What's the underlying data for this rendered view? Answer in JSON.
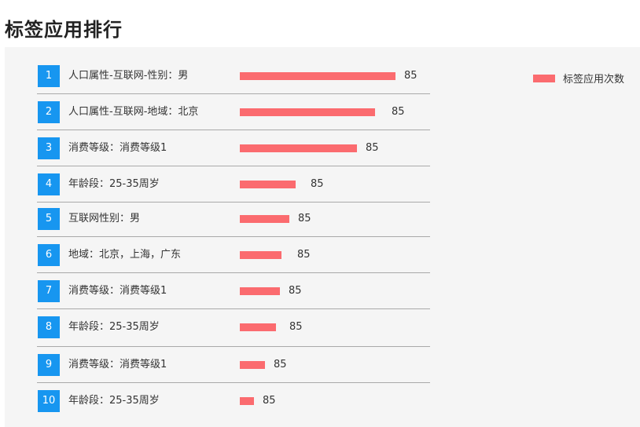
{
  "page": {
    "title": "标签应用排行"
  },
  "chart_data": {
    "type": "bar",
    "orientation": "horizontal",
    "legend": {
      "label": "标签应用次数",
      "placement": "top-right",
      "color": "#fb6b6f"
    },
    "colors": {
      "bar": "#fb6b6f",
      "rank_badge": "#1796f0"
    },
    "bar_value_scale_max": 100,
    "items": [
      {
        "rank": "1",
        "label": "人口属性-互联网-性别：男",
        "value_label": "85",
        "bar_value": 100
      },
      {
        "rank": "2",
        "label": "人口属性-互联网-地域：北京",
        "value_label": "85",
        "bar_value": 87
      },
      {
        "rank": "3",
        "label": "消费等级：消费等级1",
        "value_label": "85",
        "bar_value": 75
      },
      {
        "rank": "4",
        "label": "年龄段：25-35周岁",
        "value_label": "85",
        "bar_value": 36
      },
      {
        "rank": "5",
        "label": "互联网性别：男",
        "value_label": "85",
        "bar_value": 32
      },
      {
        "rank": "6",
        "label": "地域：北京，上海，广东",
        "value_label": "85",
        "bar_value": 27
      },
      {
        "rank": "7",
        "label": "消费等级：消费等级1",
        "value_label": "85",
        "bar_value": 26
      },
      {
        "rank": "8",
        "label": "年龄段：25-35周岁",
        "value_label": "85",
        "bar_value": 23
      },
      {
        "rank": "9",
        "label": "消费等级：消费等级1",
        "value_label": "85",
        "bar_value": 16
      },
      {
        "rank": "10",
        "label": "年龄段：25-35周岁",
        "value_label": "85",
        "bar_value": 9
      }
    ]
  }
}
